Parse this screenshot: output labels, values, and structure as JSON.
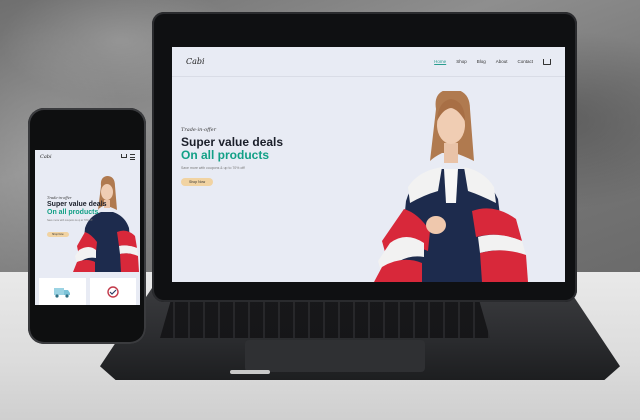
{
  "colors": {
    "accent_green": "#12a086",
    "button_peach": "#f1d3a2",
    "screen_bg": "#e8ebf4",
    "heading_dark": "#1b1f2a"
  },
  "laptop_site": {
    "logo": "Cabi",
    "nav": {
      "items": [
        "Home",
        "Shop",
        "Blog",
        "About",
        "Contact"
      ],
      "active": "Home",
      "cart_icon": "cart-icon"
    },
    "hero": {
      "tagline": "Trade-in-offer",
      "headline_line1": "Super value deals",
      "headline_line2": "On all products",
      "description": "Save more with coupons & up to 70% off!",
      "button_label": "Shop Now"
    }
  },
  "phone_site": {
    "logo": "Cabi",
    "hero": {
      "tagline": "Trade-in-offer",
      "headline_line1": "Super value deals",
      "headline_line2": "On all products",
      "description": "Save more with coupons & up to 70% off!",
      "button_label": "Shop Now"
    },
    "icons": [
      "cart-icon",
      "menu-icon"
    ]
  }
}
